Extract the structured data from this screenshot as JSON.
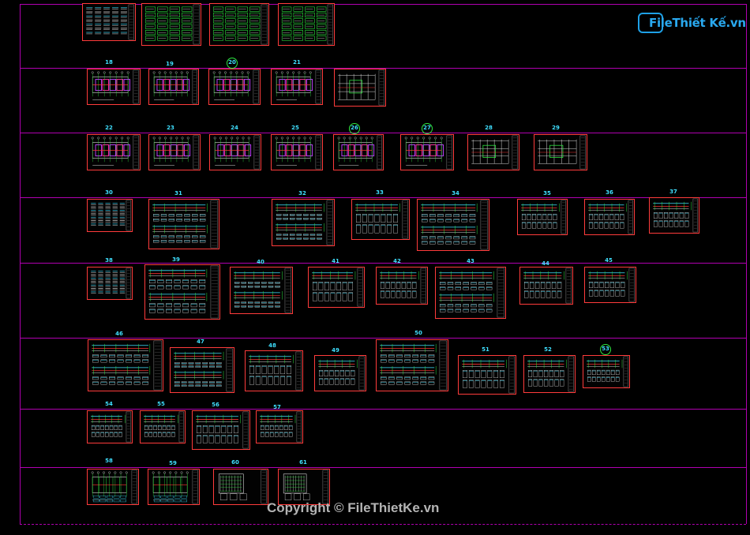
{
  "watermark": {
    "logo_text": "FileThiết Kế.vn",
    "copyright": "Copyright © FileThietKe.vn"
  },
  "colors": {
    "background": "#000000",
    "frame_line": "#b000b0",
    "sheet_border": "#ff3b3b",
    "sheet_number": "#3fe0ff",
    "circle_mark": "#2ee840",
    "logo": "#29a8ee"
  },
  "sheet_rows": [
    {
      "row": "row-top",
      "sheets": [
        {
          "label": "",
          "style": "table"
        },
        {
          "label": "",
          "style": "green"
        },
        {
          "label": "",
          "style": "green"
        },
        {
          "label": "",
          "style": "green"
        }
      ]
    },
    {
      "row": "row-18-21",
      "sheets": [
        {
          "label": "18",
          "style": "plan"
        },
        {
          "label": "19",
          "style": "plan"
        },
        {
          "label": "20",
          "style": "plan",
          "circled": true
        },
        {
          "label": "21",
          "style": "plan"
        },
        {
          "label": "",
          "style": "grid"
        }
      ]
    },
    {
      "row": "row-22-29",
      "sheets": [
        {
          "label": "22",
          "style": "plan"
        },
        {
          "label": "23",
          "style": "plan"
        },
        {
          "label": "24",
          "style": "plan"
        },
        {
          "label": "25",
          "style": "plan"
        },
        {
          "label": "26",
          "style": "plan",
          "circled": true
        },
        {
          "label": "27",
          "style": "plan",
          "circled": true
        },
        {
          "label": "28",
          "style": "grid"
        },
        {
          "label": "29",
          "style": "grid"
        }
      ]
    },
    {
      "row": "row-30-37",
      "sheets": [
        {
          "label": "30",
          "style": "table"
        },
        {
          "label": "31",
          "style": "beam"
        },
        {
          "label": "32",
          "style": "beam"
        },
        {
          "label": "33",
          "style": "beam"
        },
        {
          "label": "34",
          "style": "beam"
        },
        {
          "label": "35",
          "style": "beam"
        },
        {
          "label": "36",
          "style": "beam"
        },
        {
          "label": "37",
          "style": "beam"
        }
      ]
    },
    {
      "row": "row-38-45",
      "sheets": [
        {
          "label": "38",
          "style": "table"
        },
        {
          "label": "39",
          "style": "beam"
        },
        {
          "label": "40",
          "style": "beam"
        },
        {
          "label": "41",
          "style": "beam"
        },
        {
          "label": "42",
          "style": "beam"
        },
        {
          "label": "43",
          "style": "beam"
        },
        {
          "label": "44",
          "style": "beam"
        },
        {
          "label": "45",
          "style": "beam"
        }
      ]
    },
    {
      "row": "row-46-53",
      "sheets": [
        {
          "label": "46",
          "style": "beam"
        },
        {
          "label": "47",
          "style": "beam"
        },
        {
          "label": "48",
          "style": "beam"
        },
        {
          "label": "49",
          "style": "beam"
        },
        {
          "label": "50",
          "style": "beam"
        },
        {
          "label": "51",
          "style": "beam"
        },
        {
          "label": "52",
          "style": "beam"
        },
        {
          "label": "53",
          "style": "beam",
          "circled": true
        }
      ]
    },
    {
      "row": "row-54-57",
      "sheets": [
        {
          "label": "54",
          "style": "beam"
        },
        {
          "label": "55",
          "style": "beam"
        },
        {
          "label": "56",
          "style": "beam"
        },
        {
          "label": "57",
          "style": "beam"
        }
      ]
    },
    {
      "row": "row-58-61",
      "sheets": [
        {
          "label": "58",
          "style": "plan2"
        },
        {
          "label": "59",
          "style": "plan2"
        },
        {
          "label": "60",
          "style": "detail"
        },
        {
          "label": "61",
          "style": "detail"
        }
      ]
    }
  ]
}
